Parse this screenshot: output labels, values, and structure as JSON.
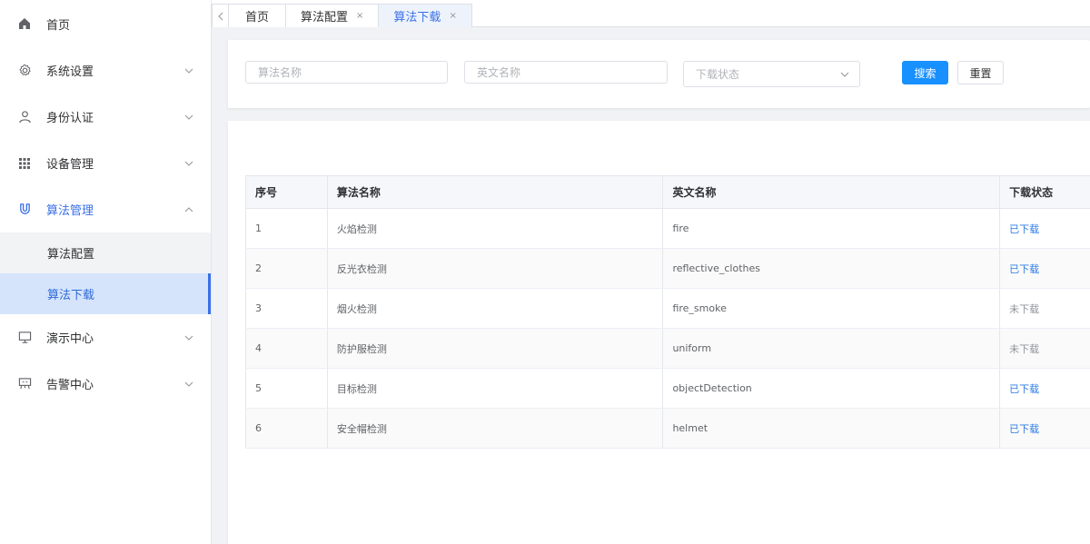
{
  "sidebar": {
    "home": "首页",
    "items": [
      {
        "label": "系统设置",
        "icon": "gear-icon"
      },
      {
        "label": "身份认证",
        "icon": "user-icon"
      },
      {
        "label": "设备管理",
        "icon": "grid-icon"
      },
      {
        "label": "算法管理",
        "icon": "magnet-icon"
      }
    ],
    "sub_items": [
      {
        "label": "算法配置"
      },
      {
        "label": "算法下载"
      }
    ],
    "items_after": [
      {
        "label": "演示中心",
        "icon": "monitor-icon"
      },
      {
        "label": "告警中心",
        "icon": "alarm-board-icon"
      }
    ]
  },
  "tabs": [
    {
      "label": "首页"
    },
    {
      "label": "算法配置",
      "close": "×"
    },
    {
      "label": "算法下载",
      "close": "×"
    }
  ],
  "search": {
    "algo_name_placeholder": "算法名称",
    "en_name_placeholder": "英文名称",
    "status_placeholder": "下载状态",
    "search_label": "搜索",
    "reset_label": "重置"
  },
  "table": {
    "headers": [
      "序号",
      "算法名称",
      "英文名称",
      "下载状态"
    ],
    "rows": [
      {
        "no": "1",
        "name": "火焰检测",
        "en": "fire",
        "status": "已下载"
      },
      {
        "no": "2",
        "name": "反光衣检测",
        "en": "reflective_clothes",
        "status": "已下载"
      },
      {
        "no": "3",
        "name": "烟火检测",
        "en": "fire_smoke",
        "status": "未下载"
      },
      {
        "no": "4",
        "name": "防护服检测",
        "en": "uniform",
        "status": "未下载"
      },
      {
        "no": "5",
        "name": "目标检测",
        "en": "objectDetection",
        "status": "已下载"
      },
      {
        "no": "6",
        "name": "安全帽检测",
        "en": "helmet",
        "status": "已下载"
      }
    ]
  },
  "colors": {
    "accent": "#3a6fe8",
    "primary_button": "#1890ff",
    "downloaded": "#2d7be5",
    "not_downloaded": "#909399"
  }
}
